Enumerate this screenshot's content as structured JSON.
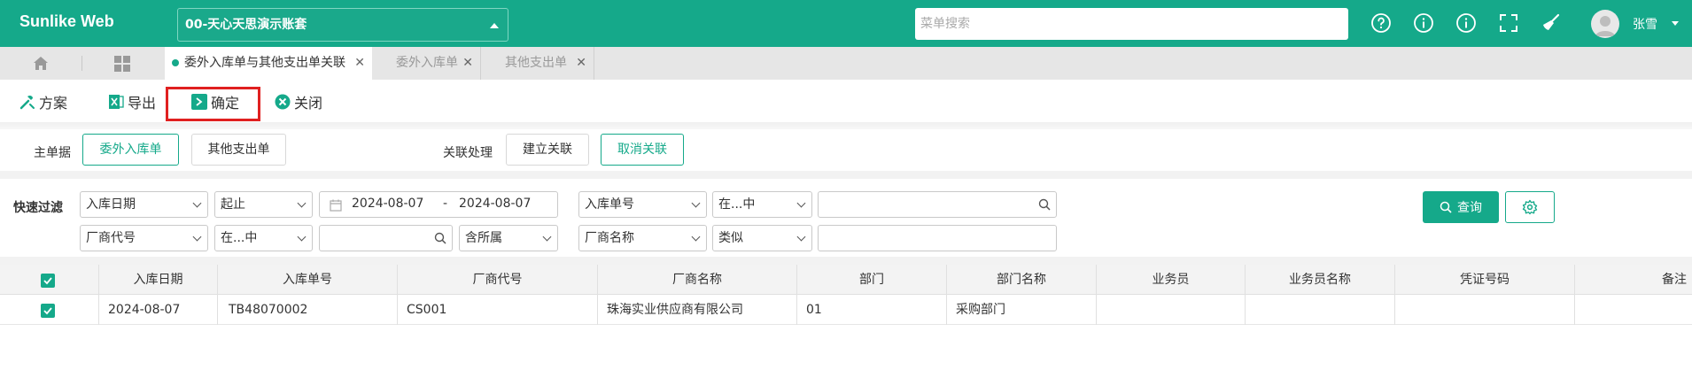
{
  "header": {
    "brand": "Sunlike Web",
    "account": "00-天心天思演示账套",
    "search_placeholder": "菜单搜索",
    "user_name": "张雪",
    "icons": [
      "help-circle-icon",
      "info-icon",
      "info-icon",
      "fullscreen-icon",
      "broom-icon"
    ],
    "accent_color": "#15a98a"
  },
  "tabs": [
    {
      "label": "委外入库单与其他支出单关联",
      "active": true
    },
    {
      "label": "委外入库单",
      "active": false
    },
    {
      "label": "其他支出单",
      "active": false
    }
  ],
  "toolbar": {
    "scheme": "方案",
    "export": "导出",
    "confirm": "确定",
    "close": "关闭"
  },
  "doc_row": {
    "main_doc_label": "主单据",
    "main_doc_options": [
      "委外入库单",
      "其他支出单"
    ],
    "relation_label": "关联处理",
    "create_relation": "建立关联",
    "cancel_relation": "取消关联"
  },
  "filter": {
    "label": "快速过滤",
    "row1": {
      "field1": "入库日期",
      "op1": "起止",
      "date_from": "2024-08-07",
      "date_dash": "-",
      "date_to": "2024-08-07",
      "field2": "入库单号",
      "op2": "在...中",
      "value2": ""
    },
    "row2": {
      "field1": "厂商代号",
      "op1": "在...中",
      "value1": "",
      "scope": "含所属",
      "field2": "厂商名称",
      "op2": "类似",
      "value2": ""
    },
    "query_button": "查询"
  },
  "grid": {
    "columns": [
      "入库日期",
      "入库单号",
      "厂商代号",
      "厂商名称",
      "部门",
      "部门名称",
      "业务员",
      "业务员名称",
      "凭证号码",
      "备注"
    ],
    "rows": [
      {
        "checked": true,
        "cells": [
          "2024-08-07",
          "TB48070002",
          "CS001",
          "珠海实业供应商有限公司",
          "01",
          "采购部门",
          "",
          "",
          "",
          ""
        ]
      }
    ],
    "header_checked": true
  }
}
